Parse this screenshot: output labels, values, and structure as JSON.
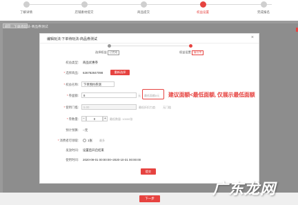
{
  "steps": [
    {
      "label": "了解详情",
      "active": false
    },
    {
      "label": "店铺素材提交",
      "active": false
    },
    {
      "label": "商品提交",
      "active": false
    },
    {
      "label": "权益设置",
      "active": true
    },
    {
      "label": "完成报名",
      "active": false
    }
  ],
  "page": {
    "tab_label": "返回",
    "title": "下单待玩法-商品券测试",
    "next_button": "下一步"
  },
  "modal": {
    "title": "编辑玩法:下单待玩法-商品券测试",
    "close_icon": "close-icon",
    "steps": [
      {
        "label": "选择权益",
        "tag": "已完成"
      },
      {
        "label": "权益设置",
        "tag": "填写中"
      }
    ],
    "fields": {
      "type_label": "权益类型:",
      "type_value": "商品优惠券",
      "select_product_label": "选择商品:",
      "product_id": "626782847098",
      "reselect_button": "重新选择",
      "name_label": "权益名称:",
      "name_value": "下单预约券测",
      "face_value_label": "券面额:",
      "face_value": "8",
      "face_unit": "元",
      "face_hint": "最低面额8元",
      "threshold_label": "使用门槛:",
      "threshold_value": "5.00",
      "threshold_hint": "最低折扣力度:",
      "threshold_hint2": "无门槛",
      "count_label": "券数量:",
      "count_value": "0",
      "count_hint": "最低数量: 10000张",
      "budget_label": "预计预算:",
      "budget_value": "--元",
      "limit_label": "消费者可领取:",
      "limit_value": "1张",
      "limit_hint": "最多",
      "after_label": "发放时间:",
      "after_value": "设置后开启结束",
      "period_label": "使用时间:",
      "period_value": "2020-09-01 00:00:00~2020-10-31 00:00:00",
      "submit_button": "提交"
    }
  },
  "annotation": "建议面额<最低面额, 仅展示最低面额",
  "watermark": "广东龙网",
  "colors": {
    "accent": "#e64340",
    "backdrop": "#9a9a9a"
  }
}
